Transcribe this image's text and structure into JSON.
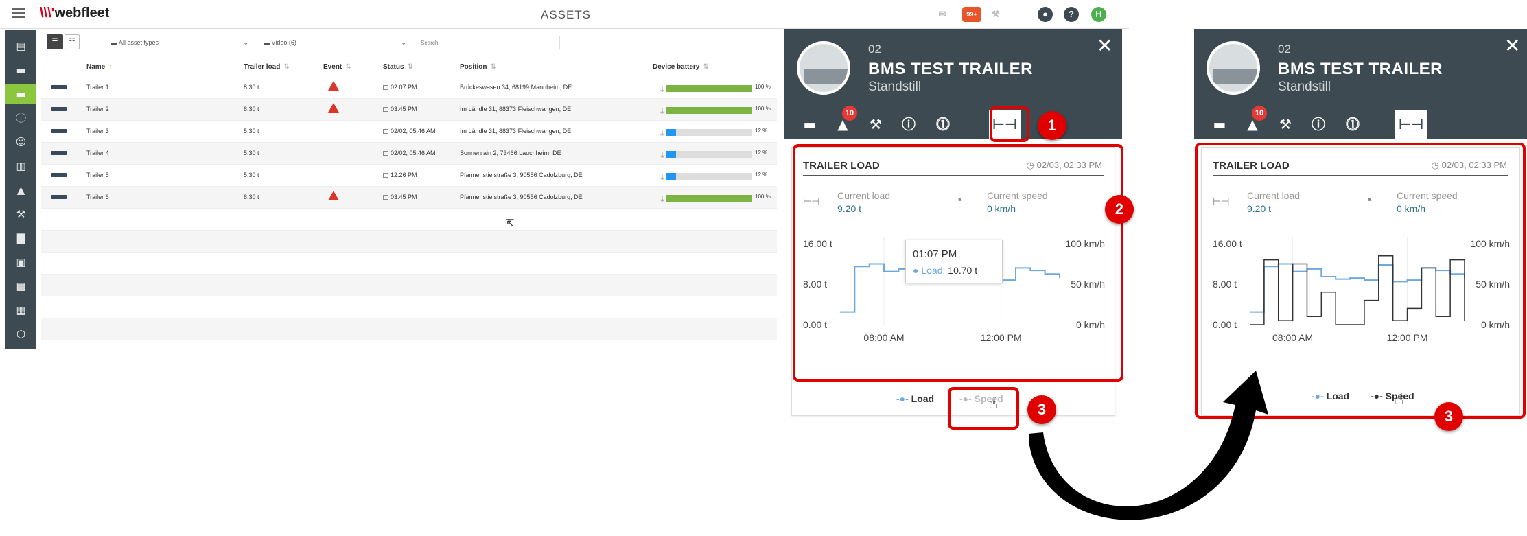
{
  "app": {
    "logo": "webfleet",
    "title": "ASSETS",
    "badge": "99+",
    "avatar": "H"
  },
  "sidebar": {
    "items": [
      {
        "icon": "map-icon",
        "glyph": "▤"
      },
      {
        "icon": "car-icon",
        "glyph": "▬"
      },
      {
        "icon": "trailer-icon",
        "glyph": "▬",
        "active": true
      },
      {
        "icon": "alert-circle-icon",
        "glyph": "ⓘ"
      },
      {
        "icon": "person-icon",
        "glyph": "☺"
      },
      {
        "icon": "clipboard-icon",
        "glyph": "▥"
      },
      {
        "icon": "warning-icon",
        "glyph": "▲"
      },
      {
        "icon": "wrench-icon",
        "glyph": "⚒"
      },
      {
        "icon": "chart-icon",
        "glyph": "▇"
      },
      {
        "icon": "truck-icon",
        "glyph": "▣"
      },
      {
        "icon": "camera-icon",
        "glyph": "▩"
      },
      {
        "icon": "grid-icon",
        "glyph": "▦"
      },
      {
        "icon": "hexagon-icon",
        "glyph": "⬡"
      }
    ]
  },
  "filters": {
    "asset_types": "All asset types",
    "video": "Video (6)",
    "search_placeholder": "Search"
  },
  "table": {
    "columns": [
      "Name",
      "Trailer load",
      "Event",
      "Status",
      "Position",
      "Device battery"
    ],
    "rows": [
      {
        "name": "Trailer 1",
        "load": "8.30 t",
        "event": true,
        "status": "02:07 PM",
        "position": "Brückeswasen 34, 68199  Mannheim, DE",
        "battery_pct": "100 %",
        "battery_level": 100,
        "battery_color": "#7cb342",
        "plug": "⏚"
      },
      {
        "name": "Trailer 2",
        "load": "8.30 t",
        "event": true,
        "status": "03:45 PM",
        "position": "Im Ländle 31, 88373  Fleischwangen, DE",
        "battery_pct": "100 %",
        "battery_level": 100,
        "battery_color": "#7cb342",
        "plug": "⏚"
      },
      {
        "name": "Trailer 3",
        "load": "5.30 t",
        "event": false,
        "status": "02/02, 05:46 AM",
        "position": "Im Ländle 31, 88373  Fleischwangen, DE",
        "battery_pct": "12 %",
        "battery_level": 12,
        "battery_color": "#2196f3",
        "plug": "⏚"
      },
      {
        "name": "Trailer 4",
        "load": "5.30 t",
        "event": false,
        "status": "02/02, 05:46 AM",
        "position": "Sonnenrain 2, 73466  Lauchheim, DE",
        "battery_pct": "12 %",
        "battery_level": 12,
        "battery_color": "#2196f3",
        "plug": "⏚"
      },
      {
        "name": "Trailer 5",
        "load": "5.30 t",
        "event": false,
        "status": "12:26 PM",
        "position": "Pfannenstielstraße 3, 90556  Cadolzburg, DE",
        "battery_pct": "12 %",
        "battery_level": 12,
        "battery_color": "#2196f3",
        "plug": "⏚"
      },
      {
        "name": "Trailer 6",
        "load": "8.30 t",
        "event": true,
        "status": "03:45 PM",
        "position": "Pfannenstielstraße 3, 90556  Cadolzburg, DE",
        "battery_pct": "100 %",
        "battery_level": 100,
        "battery_color": "#7cb342",
        "plug": "⏚"
      }
    ]
  },
  "panel": {
    "number": "02",
    "name": "BMS TEST TRAILER",
    "state": "Standstill",
    "alert_badge": "10",
    "card_title": "TRAILER LOAD",
    "card_date": "02/03, 02:33 PM",
    "current_load_label": "Current load",
    "current_load_value": "9.20 t",
    "current_speed_label": "Current speed",
    "current_speed_value": "0 km/h",
    "tooltip_time": "01:07 PM",
    "tooltip_label": "Load:",
    "tooltip_value": "10.70 t",
    "legend_load": "Load",
    "legend_speed": "Speed"
  },
  "annotations": {
    "one": "1",
    "two": "2",
    "three": "3"
  },
  "chart_data": [
    {
      "type": "line",
      "title": "TRAILER LOAD",
      "x": [
        "06:30",
        "07:00",
        "07:30",
        "08:00",
        "08:30",
        "09:00",
        "09:30",
        "10:00",
        "10:30",
        "11:00",
        "11:30",
        "12:00",
        "12:30",
        "13:00",
        "13:30",
        "14:00"
      ],
      "x_ticks": [
        "08:00 AM",
        "12:00 PM"
      ],
      "y_left_ticks": [
        "16.00 t",
        "8.00 t",
        "0.00 t"
      ],
      "y_right_ticks": [
        "100 km/h",
        "50 km/h",
        "0 km/h"
      ],
      "ylim_left": [
        0,
        16
      ],
      "ylim_right": [
        0,
        100
      ],
      "series": [
        {
          "name": "Load",
          "axis": "left",
          "visible": true,
          "color": "#6fa8dc",
          "values": [
            2.5,
            11.5,
            12.0,
            10.5,
            11.0,
            9.5,
            9.0,
            9.2,
            8.8,
            11.8,
            8.5,
            8.8,
            11.2,
            10.7,
            10.0,
            9.2
          ]
        },
        {
          "name": "Speed",
          "axis": "right",
          "visible": false,
          "color": "#333333",
          "values": [
            0,
            0,
            0,
            0,
            0,
            0,
            0,
            0,
            0,
            0,
            0,
            0,
            0,
            0,
            0,
            0
          ]
        }
      ]
    },
    {
      "type": "line",
      "title": "TRAILER LOAD",
      "x": [
        "06:30",
        "07:00",
        "07:30",
        "08:00",
        "08:30",
        "09:00",
        "09:30",
        "10:00",
        "10:30",
        "11:00",
        "11:30",
        "12:00",
        "12:30",
        "13:00",
        "13:30",
        "14:00"
      ],
      "x_ticks": [
        "08:00 AM",
        "12:00 PM"
      ],
      "y_left_ticks": [
        "16.00 t",
        "8.00 t",
        "0.00 t"
      ],
      "y_right_ticks": [
        "100 km/h",
        "50 km/h",
        "0 km/h"
      ],
      "ylim_left": [
        0,
        16
      ],
      "ylim_right": [
        0,
        100
      ],
      "series": [
        {
          "name": "Load",
          "axis": "left",
          "visible": true,
          "color": "#6fa8dc",
          "values": [
            2.5,
            11.5,
            12.0,
            10.5,
            11.0,
            9.5,
            9.0,
            9.2,
            8.8,
            11.8,
            8.5,
            8.8,
            11.2,
            10.7,
            10.0,
            9.2
          ]
        },
        {
          "name": "Speed",
          "axis": "right",
          "visible": true,
          "color": "#333333",
          "values": [
            0,
            80,
            5,
            75,
            10,
            40,
            0,
            0,
            30,
            85,
            5,
            20,
            70,
            10,
            80,
            5
          ]
        }
      ]
    }
  ]
}
